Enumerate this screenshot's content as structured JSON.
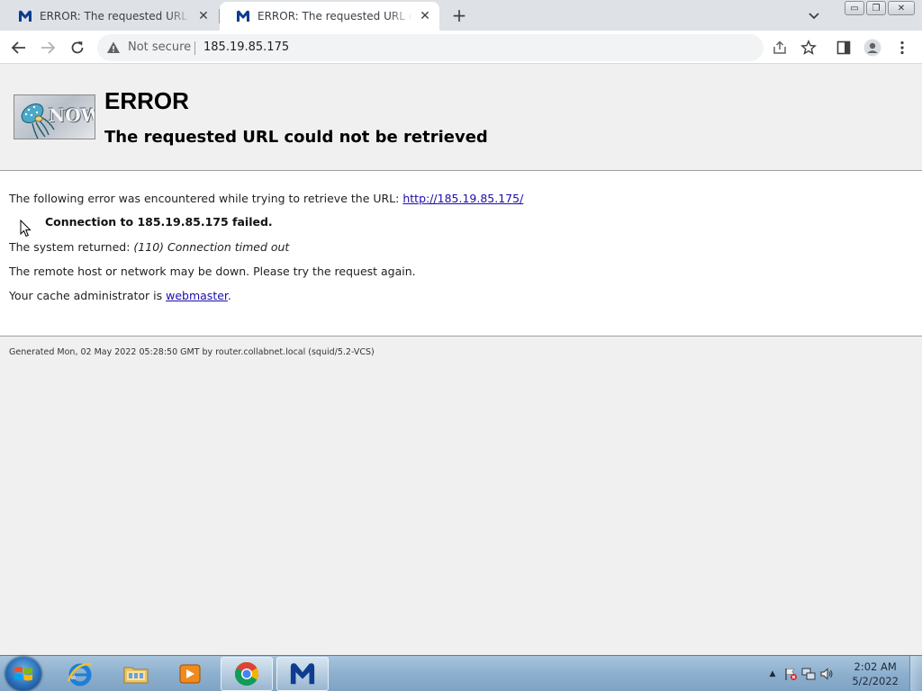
{
  "browser": {
    "tabs": [
      {
        "title": "ERROR: The requested URL could not be retrieved",
        "active": false
      },
      {
        "title": "ERROR: The requested URL could not be retrieved",
        "active": true
      }
    ],
    "new_tab_glyph": "+",
    "close_glyph": "✕",
    "address": {
      "security_label": "Not secure",
      "url": "185.19.85.175"
    },
    "window_controls": {
      "minimize": "▭",
      "restore": "❐",
      "close": "✕"
    }
  },
  "page": {
    "logo_text": "NOW",
    "heading": "ERROR",
    "subheading": "The requested URL could not be retrieved",
    "intro_text": "The following error was encountered while trying to retrieve the URL: ",
    "intro_link": "http://185.19.85.175/",
    "error_detail": "Connection to 185.19.85.175 failed.",
    "system_returned_label": "The system returned: ",
    "system_returned_value": "(110) Connection timed out",
    "advice": "The remote host or network may be down. Please try the request again.",
    "admin_text": "Your cache administrator is ",
    "admin_link": "webmaster",
    "admin_suffix": ".",
    "footer": "Generated Mon, 02 May 2022 05:28:50 GMT by router.collabnet.local (squid/5.2-VCS)"
  },
  "taskbar": {
    "apps": [
      "internet-explorer",
      "file-explorer",
      "media-player",
      "chrome",
      "malwarebytes"
    ],
    "clock_time": "2:02 AM",
    "clock_date": "5/2/2022",
    "tray_arrow": "▲"
  },
  "colors": {
    "link": "#1a0dab",
    "chrome_tabbar": "#dee1e6",
    "malwarebytes_blue": "#0d3c91"
  }
}
